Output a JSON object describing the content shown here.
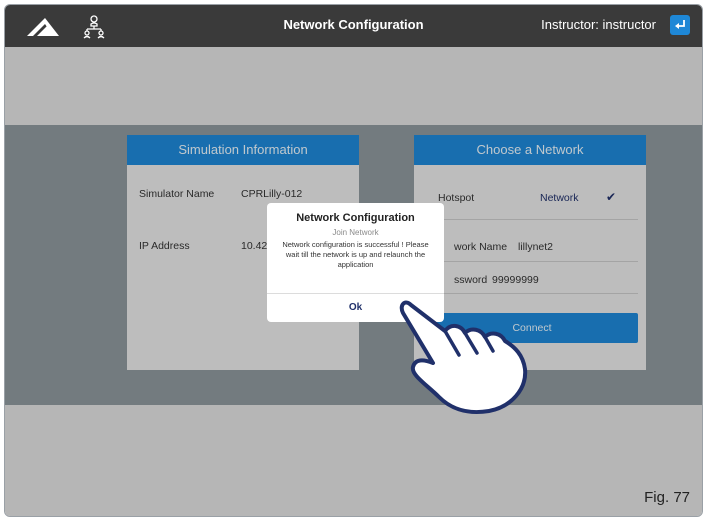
{
  "header": {
    "title": "Network Configuration",
    "instructor_label": "Instructor: instructor"
  },
  "simulation_panel": {
    "title": "Simulation Information",
    "simulator_name_label": "Simulator Name",
    "simulator_name_value": "CPRLilly-012",
    "ip_label": "IP Address",
    "ip_value": "10.42"
  },
  "network_panel": {
    "title": "Choose a Network",
    "hotspot_label": "Hotspot",
    "network_label": "Network",
    "network_name_label": "work Name",
    "network_name_value": "lillynet2",
    "password_label": "ssword",
    "password_value": "99999999",
    "connect_label": "Connect"
  },
  "dialog": {
    "title": "Network Configuration",
    "subtitle": "Join Network",
    "message_lines": [
      "Network configuration is successful ! Please",
      "wait till the network is up and relaunch the",
      "application"
    ],
    "ok_label": "Ok"
  },
  "figure_label": "Fig. 77",
  "colors": {
    "topbar": "#3a3a3a",
    "accent": "#1e87d6",
    "dark_band": "#8d969c",
    "light_band": "#dedede",
    "ok_text": "#20306a"
  },
  "icons": {
    "logo": "3b-logo-icon",
    "network": "network-tree-icon",
    "logout": "return-arrow-icon",
    "check": "checkmark-icon",
    "hand": "pointing-hand-icon"
  }
}
